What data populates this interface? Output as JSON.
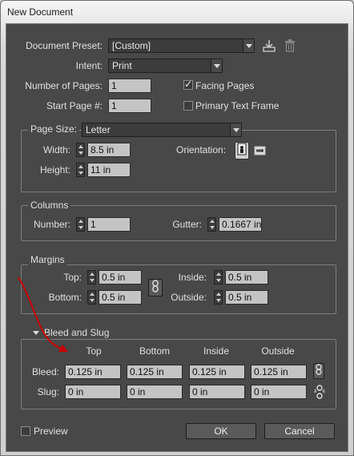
{
  "window": {
    "title": "New Document"
  },
  "top": {
    "preset_label": "Document Preset:",
    "preset_value": "[Custom]",
    "intent_label": "Intent:",
    "intent_value": "Print",
    "pages_label": "Number of Pages:",
    "pages_value": "1",
    "facing_label": "Facing Pages",
    "facing_checked": true,
    "start_label": "Start Page #:",
    "start_value": "1",
    "primary_label": "Primary Text Frame",
    "primary_checked": false
  },
  "page_size": {
    "label": "Page Size:",
    "value": "Letter",
    "width_label": "Width:",
    "width_value": "8.5 in",
    "height_label": "Height:",
    "height_value": "11 in",
    "orientation_label": "Orientation:"
  },
  "columns": {
    "label": "Columns",
    "number_label": "Number:",
    "number_value": "1",
    "gutter_label": "Gutter:",
    "gutter_value": "0.1667 in"
  },
  "margins": {
    "label": "Margins",
    "top_label": "Top:",
    "top_value": "0.5 in",
    "bottom_label": "Bottom:",
    "bottom_value": "0.5 in",
    "inside_label": "Inside:",
    "inside_value": "0.5 in",
    "outside_label": "Outside:",
    "outside_value": "0.5 in"
  },
  "bleed_slug": {
    "label": "Bleed and Slug",
    "col_top": "Top",
    "col_bottom": "Bottom",
    "col_inside": "Inside",
    "col_outside": "Outside",
    "bleed_label": "Bleed:",
    "bleed_values": [
      "0.125 in",
      "0.125 in",
      "0.125 in",
      "0.125 in"
    ],
    "slug_label": "Slug:",
    "slug_values": [
      "0 in",
      "0 in",
      "0 in",
      "0 in"
    ]
  },
  "footer": {
    "preview_label": "Preview",
    "preview_checked": false,
    "ok_label": "OK",
    "cancel_label": "Cancel"
  },
  "icons": {
    "save_preset": "save-preset-icon",
    "delete_preset": "trash-icon",
    "portrait": "portrait-orientation-icon",
    "landscape": "landscape-orientation-icon",
    "chain": "chain-link-icon",
    "chain_broken": "chain-broken-icon"
  },
  "colors": {
    "annotation_arrow": "#cc0000",
    "dialog_bg": "#484848"
  }
}
